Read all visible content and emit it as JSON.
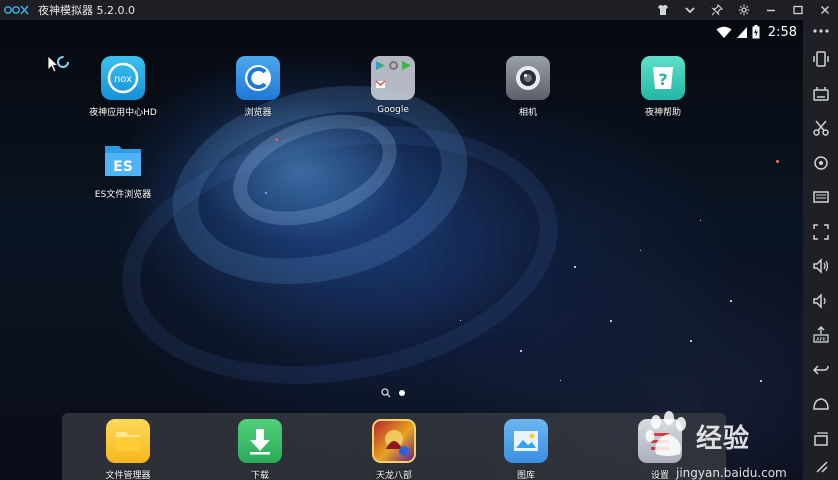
{
  "window": {
    "logo_text": "nox",
    "title": "夜神模拟器 5.2.0.0",
    "controls": [
      "shirt-icon",
      "chevron-down-icon",
      "pin-icon",
      "gear-icon",
      "minimize-icon",
      "maximize-icon",
      "close-icon"
    ]
  },
  "statusbar": {
    "time": "2:58"
  },
  "desktop": {
    "apps": [
      {
        "label": "夜神应用中心HD",
        "icon": "nox-app-center-icon"
      },
      {
        "label": "浏览器",
        "icon": "browser-icon"
      },
      {
        "label": "Google",
        "icon": "google-folder-icon"
      },
      {
        "label": "相机",
        "icon": "camera-icon"
      },
      {
        "label": "夜神帮助",
        "icon": "help-icon"
      },
      {
        "label": "ES文件浏览器",
        "icon": "es-file-explorer-icon"
      }
    ],
    "pages": 2,
    "current_page": 2
  },
  "dock": {
    "apps": [
      {
        "label": "文件管理器",
        "icon": "file-manager-icon"
      },
      {
        "label": "下载",
        "icon": "download-icon"
      },
      {
        "label": "天龙八部",
        "icon": "game-icon"
      },
      {
        "label": "图库",
        "icon": "gallery-icon"
      },
      {
        "label": "设置",
        "icon": "settings-icon"
      }
    ]
  },
  "sidebar": {
    "tools": [
      "shake-icon",
      "keyboard-icon",
      "screenshot-scissors-icon",
      "location-icon",
      "display-icon",
      "fullscreen-icon",
      "volume-up-icon",
      "volume-down-icon",
      "apk-install-icon",
      "back-icon",
      "home-icon",
      "recent-apps-icon"
    ]
  },
  "watermark": {
    "brand": "经验",
    "url": "jingyan.baidu.com"
  },
  "colors": {
    "titlebar": "#1d1f24",
    "sidebar": "#1e2025",
    "nox_blue": "#39b6e8"
  }
}
